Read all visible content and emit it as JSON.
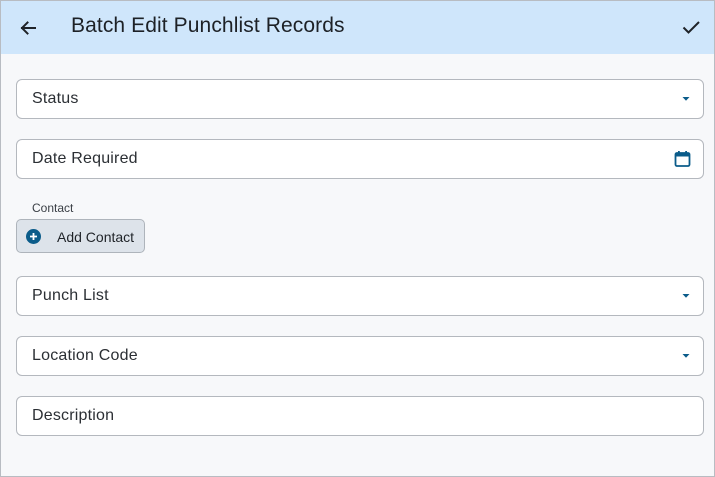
{
  "header": {
    "title": "Batch Edit Punchlist Records",
    "back_icon": "arrow-left-icon",
    "confirm_icon": "check-icon"
  },
  "fields": {
    "status": {
      "label": "Status",
      "icon": "dropdown-arrow-icon"
    },
    "date_required": {
      "label": "Date Required",
      "icon": "calendar-icon"
    },
    "punch_list": {
      "label": "Punch List",
      "icon": "dropdown-arrow-icon"
    },
    "location_code": {
      "label": "Location Code",
      "icon": "dropdown-arrow-icon"
    },
    "description": {
      "label": "Description"
    }
  },
  "contact": {
    "caption": "Contact",
    "add_label": "Add Contact",
    "add_icon": "add-circle-icon"
  },
  "colors": {
    "header_bg": "#cfe6fb",
    "accent": "#0b5c8a",
    "background": "#f7f8fa"
  }
}
